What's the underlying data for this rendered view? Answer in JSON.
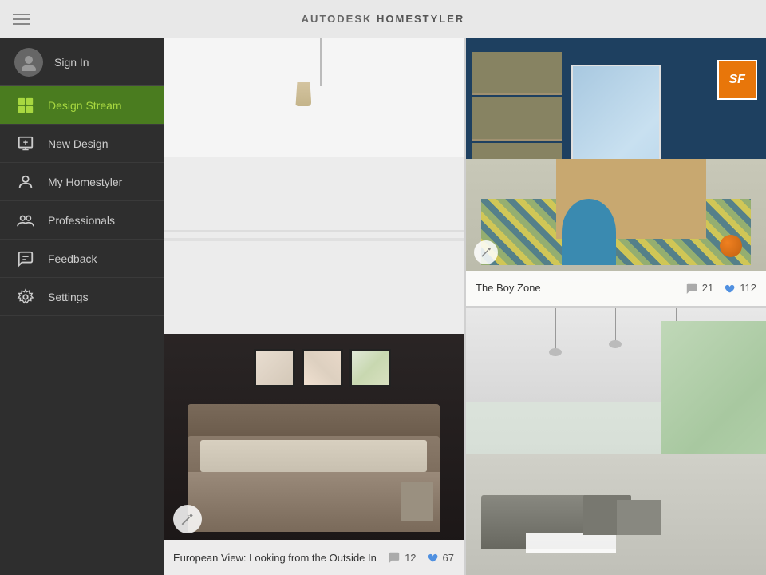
{
  "app": {
    "title_prefix": "AUTODESK",
    "title_suffix": "HOMESTYLER",
    "title_superscript": "®"
  },
  "header": {
    "menu_label": "menu"
  },
  "sidebar": {
    "sign_in_label": "Sign In",
    "items": [
      {
        "id": "design-stream",
        "label": "Design Stream",
        "active": true
      },
      {
        "id": "new-design",
        "label": "New Design",
        "active": false
      },
      {
        "id": "my-homestyler",
        "label": "My Homestyler",
        "active": false
      },
      {
        "id": "professionals",
        "label": "Professionals",
        "active": false
      },
      {
        "id": "feedback",
        "label": "Feedback",
        "active": false
      },
      {
        "id": "settings",
        "label": "Settings",
        "active": false
      }
    ]
  },
  "panels": {
    "main": {
      "caption": "European View: Looking from the Outside In",
      "comments": "12",
      "likes": "67"
    },
    "top_right": {
      "title": "The Boy Zone",
      "comments": "21",
      "likes": "112"
    },
    "bottom_right": {
      "title": "",
      "comments": "",
      "likes": ""
    }
  },
  "icons": {
    "menu": "☰",
    "avatar": "👤",
    "chat_bubble": "💬",
    "heart": "♥",
    "render": "✦",
    "sf_text": "SF"
  }
}
